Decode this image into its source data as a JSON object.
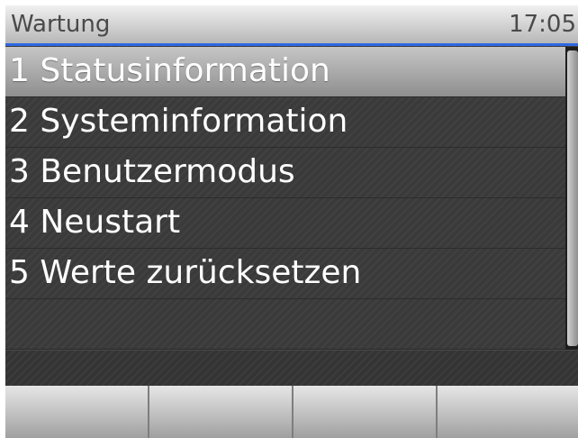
{
  "header": {
    "title": "Wartung",
    "time": "17:05",
    "accent_color": "#2f68e0"
  },
  "menu": {
    "items": [
      {
        "label": "1 Statusinformation",
        "selected": true
      },
      {
        "label": "2 Systeminformation",
        "selected": false
      },
      {
        "label": "3 Benutzermodus",
        "selected": false
      },
      {
        "label": "4 Neustart",
        "selected": false
      },
      {
        "label": "5 Werte zurücksetzen",
        "selected": false
      }
    ]
  },
  "softkeys": [
    {
      "label": ""
    },
    {
      "label": ""
    },
    {
      "label": ""
    },
    {
      "label": ""
    }
  ]
}
